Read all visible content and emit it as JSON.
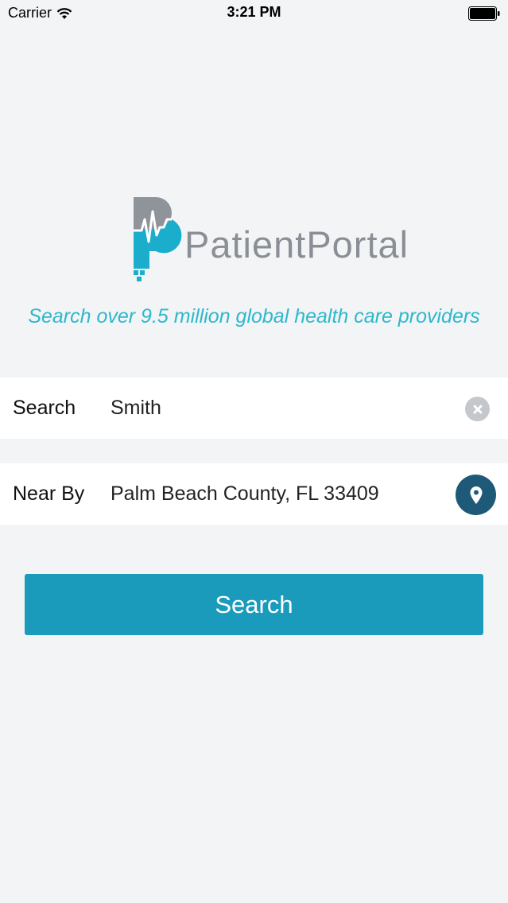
{
  "status_bar": {
    "carrier": "Carrier",
    "time": "3:21 PM"
  },
  "logo": {
    "brand_text": "PatientPortal"
  },
  "tagline": "Search over 9.5 million global health care providers",
  "search_field": {
    "label": "Search",
    "value": "Smith"
  },
  "near_field": {
    "label": "Near By",
    "value": "Palm Beach County, FL 33409"
  },
  "search_button": {
    "label": "Search"
  },
  "icons": {
    "wifi": "wifi-icon",
    "battery": "battery-icon",
    "clear": "clear-icon",
    "location": "location-pin-icon"
  },
  "colors": {
    "accent": "#1a9bbb",
    "tagline": "#2db8cc",
    "location_button": "#1e5a78",
    "logo_gray": "#8a8f96"
  }
}
